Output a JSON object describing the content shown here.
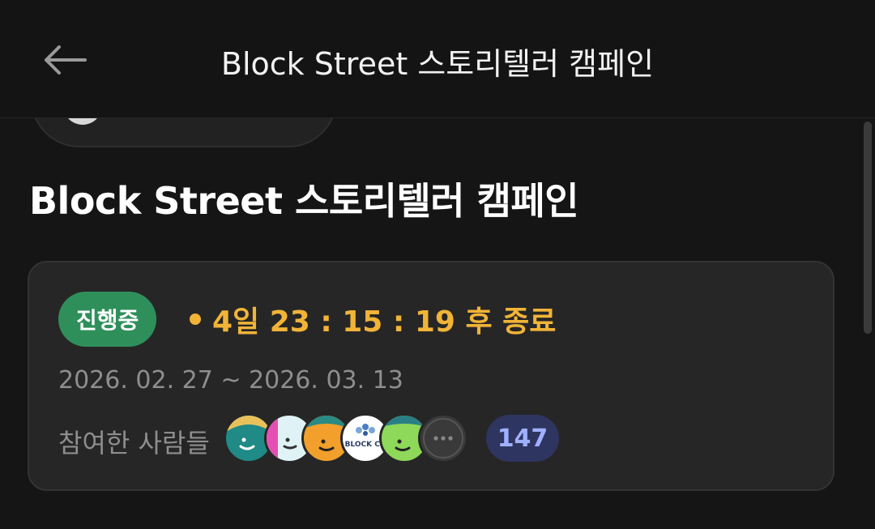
{
  "header": {
    "title": "Block Street 스토리텔러 캠페인",
    "back_icon": "arrow-left-icon"
  },
  "campaign": {
    "title": "Block Street 스토리텔러 캠페인",
    "status": "진행중",
    "countdown": "4일 23 : 15 : 19 후 종료",
    "date_range": "2026. 02. 27 ~ 2026. 03. 13",
    "participants_label": "참여한 사람들",
    "participant_count": "147",
    "logo_text": "BLOCK CH",
    "colors": {
      "status_bg": "#2f8f5b",
      "countdown": "#f1b437",
      "count_badge_bg": "#2e3560",
      "count_badge_text": "#9fb0ff"
    }
  }
}
